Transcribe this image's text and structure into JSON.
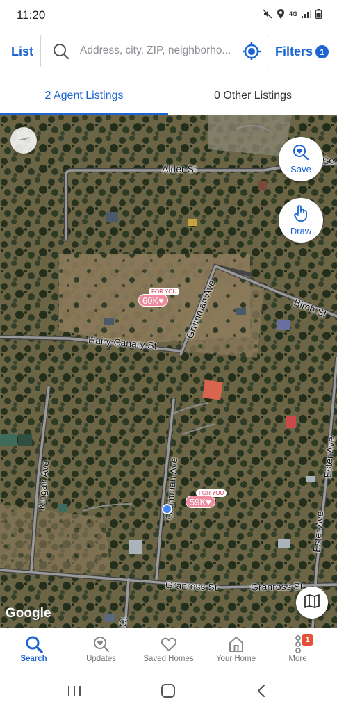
{
  "status_bar": {
    "time": "11:20",
    "network": "4G"
  },
  "header": {
    "list_label": "List",
    "search_placeholder": "Address, city, ZIP, neighborho...",
    "filters_label": "Filters",
    "filters_count": "1"
  },
  "tabs": [
    {
      "label": "2 Agent Listings",
      "active": true
    },
    {
      "label": "0 Other Listings",
      "active": false
    }
  ],
  "map": {
    "save_label": "Save",
    "draw_label": "Draw",
    "google_label": "Google",
    "roads": {
      "alder": "Alder St",
      "birch": "Birch St",
      "hairy_canary": "Hairy Canary St",
      "grumman_upper": "Grumman Ave",
      "grumman_lower": "Grumman Ave",
      "kingair": "Kingair Ave",
      "ester": "Ester Ave",
      "granross_left": "Granross St",
      "granross_right": "Granross St",
      "s_edge": "Se",
      "ct_edge": "Ct"
    },
    "listings": [
      {
        "tag": "FOR YOU",
        "price": "60K♥"
      },
      {
        "tag": "FOR YOU",
        "price": "59K♥"
      }
    ]
  },
  "bottom_nav": [
    {
      "label": "Search",
      "icon": "search-icon",
      "active": true
    },
    {
      "label": "Updates",
      "icon": "updates-icon",
      "active": false
    },
    {
      "label": "Saved Homes",
      "icon": "heart-icon",
      "active": false
    },
    {
      "label": "Your Home",
      "icon": "home-icon",
      "active": false
    },
    {
      "label": "More",
      "icon": "more-icon",
      "active": false,
      "badge": "1"
    }
  ],
  "colors": {
    "accent": "#1b64d2",
    "marker": "#ef8a9f",
    "badge": "#e5503b"
  }
}
